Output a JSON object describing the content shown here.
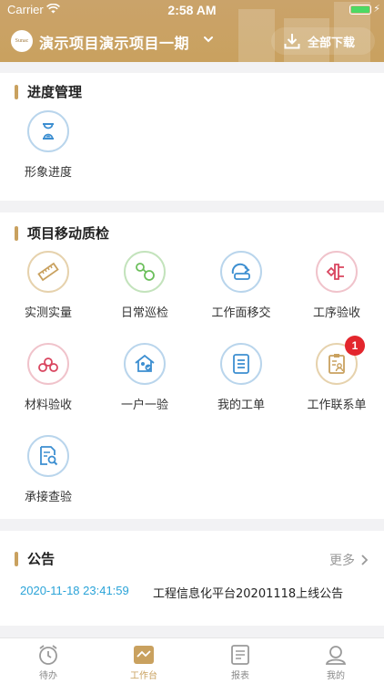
{
  "status_bar": {
    "carrier": "Carrier",
    "time": "2:58 AM"
  },
  "header": {
    "logo_text": "Sunac",
    "project_title": "演示项目演示项目一期",
    "download_label": "全部下载"
  },
  "progress_section": {
    "title": "进度管理",
    "items": [
      {
        "label": "形象进度",
        "icon": "hourglass-icon"
      }
    ]
  },
  "quality_section": {
    "title": "项目移动质检",
    "items": [
      {
        "label": "实测实量",
        "icon": "ruler-icon"
      },
      {
        "label": "日常巡检",
        "icon": "inspection-icon"
      },
      {
        "label": "工作面移交",
        "icon": "handover-icon"
      },
      {
        "label": "工序验收",
        "icon": "process-icon"
      },
      {
        "label": "材料验收",
        "icon": "materials-icon"
      },
      {
        "label": "一户一验",
        "icon": "house-check-icon"
      },
      {
        "label": "我的工单",
        "icon": "work-order-icon"
      },
      {
        "label": "工作联系单",
        "icon": "contact-sheet-icon",
        "badge": "1"
      },
      {
        "label": "承接查验",
        "icon": "document-search-icon"
      }
    ]
  },
  "notice_section": {
    "title": "公告",
    "more_label": "更多",
    "items": [
      {
        "time": "2020-11-18 23:41:59",
        "text": "工程信息化平台20201118上线公告"
      }
    ]
  },
  "tab_bar": {
    "tabs": [
      {
        "label": "待办",
        "icon": "alarm-clock-icon"
      },
      {
        "label": "工作台",
        "icon": "workbench-icon",
        "active": true
      },
      {
        "label": "报表",
        "icon": "report-icon"
      },
      {
        "label": "我的",
        "icon": "profile-icon"
      }
    ]
  },
  "colors": {
    "brand": "#c9a15f",
    "accent_blue": "#2aa3d8",
    "badge": "#e3262d",
    "icon_gold": "#c9a15f",
    "icon_green": "#6bbf5b",
    "icon_blue": "#3d8fd1",
    "icon_red": "#d9455f"
  }
}
